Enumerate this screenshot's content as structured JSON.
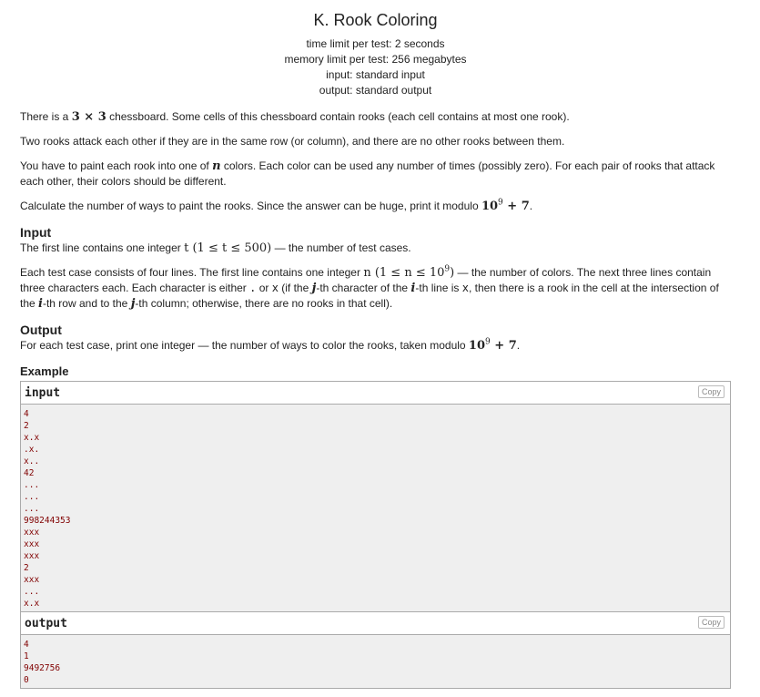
{
  "problem": {
    "title": "K. Rook Coloring",
    "limits": [
      "time limit per test: 2 seconds",
      "memory limit per test: 256 megabytes",
      "input: standard input",
      "output: standard output"
    ]
  },
  "statement": {
    "p1_a": "There is a ",
    "p1_math": "3 × 3",
    "p1_b": " chessboard. Some cells of this chessboard contain rooks (each cell contains at most one rook).",
    "p2": "Two rooks attack each other if they are in the same row (or column), and there are no other rooks between them.",
    "p3_a": "You have to paint each rook into one of ",
    "p3_math": "n",
    "p3_b": " colors. Each color can be used any number of times (possibly zero). For each pair of rooks that attack each other, their colors should be different.",
    "p4_a": "Calculate the number of ways to paint the rooks. Since the answer can be huge, print it modulo ",
    "p4_math_base": "10",
    "p4_math_exp": "9",
    "p4_math_tail": " + 7",
    "p4_b": "."
  },
  "input_section": {
    "title": "Input",
    "p1_a": "The first line contains one integer ",
    "p1_math": "t (1 ≤ t ≤ 500)",
    "p1_b": " — the number of test cases.",
    "p2_a": "Each test case consists of four lines. The first line contains one integer ",
    "p2_math_a": "n (1 ≤ n ≤ 10",
    "p2_math_exp": "9",
    "p2_math_b": ")",
    "p2_b": " — the number of colors. The next three lines contain three characters each. Each character is either ",
    "p2_dot": ".",
    "p2_c": " or ",
    "p2_x": "x",
    "p2_d": " (if the ",
    "p2_j": "j",
    "p2_e": "-th character of the ",
    "p2_i": "i",
    "p2_f": "-th line is ",
    "p2_x2": "x",
    "p2_g": ", then there is a rook in the cell at the intersection of the ",
    "p2_i2": "i",
    "p2_h": "-th row and to the ",
    "p2_j2": "j",
    "p2_k": "-th column; otherwise, there are no rooks in that cell)."
  },
  "output_section": {
    "title": "Output",
    "p1_a": "For each test case, print one integer — the number of ways to color the rooks, taken modulo ",
    "p1_math_base": "10",
    "p1_math_exp": "9",
    "p1_math_tail": " + 7",
    "p1_b": "."
  },
  "example": {
    "title": "Example",
    "copy_label": "Copy",
    "input_title": "input",
    "output_title": "output",
    "input_lines": [
      "4",
      "2",
      "x.x",
      ".x.",
      "x..",
      "42",
      "...",
      "...",
      "...",
      "998244353",
      "xxx",
      "xxx",
      "xxx",
      "2",
      "xxx",
      "...",
      "x.x"
    ],
    "output_lines": [
      "4",
      "1",
      "9492756",
      "0"
    ]
  }
}
